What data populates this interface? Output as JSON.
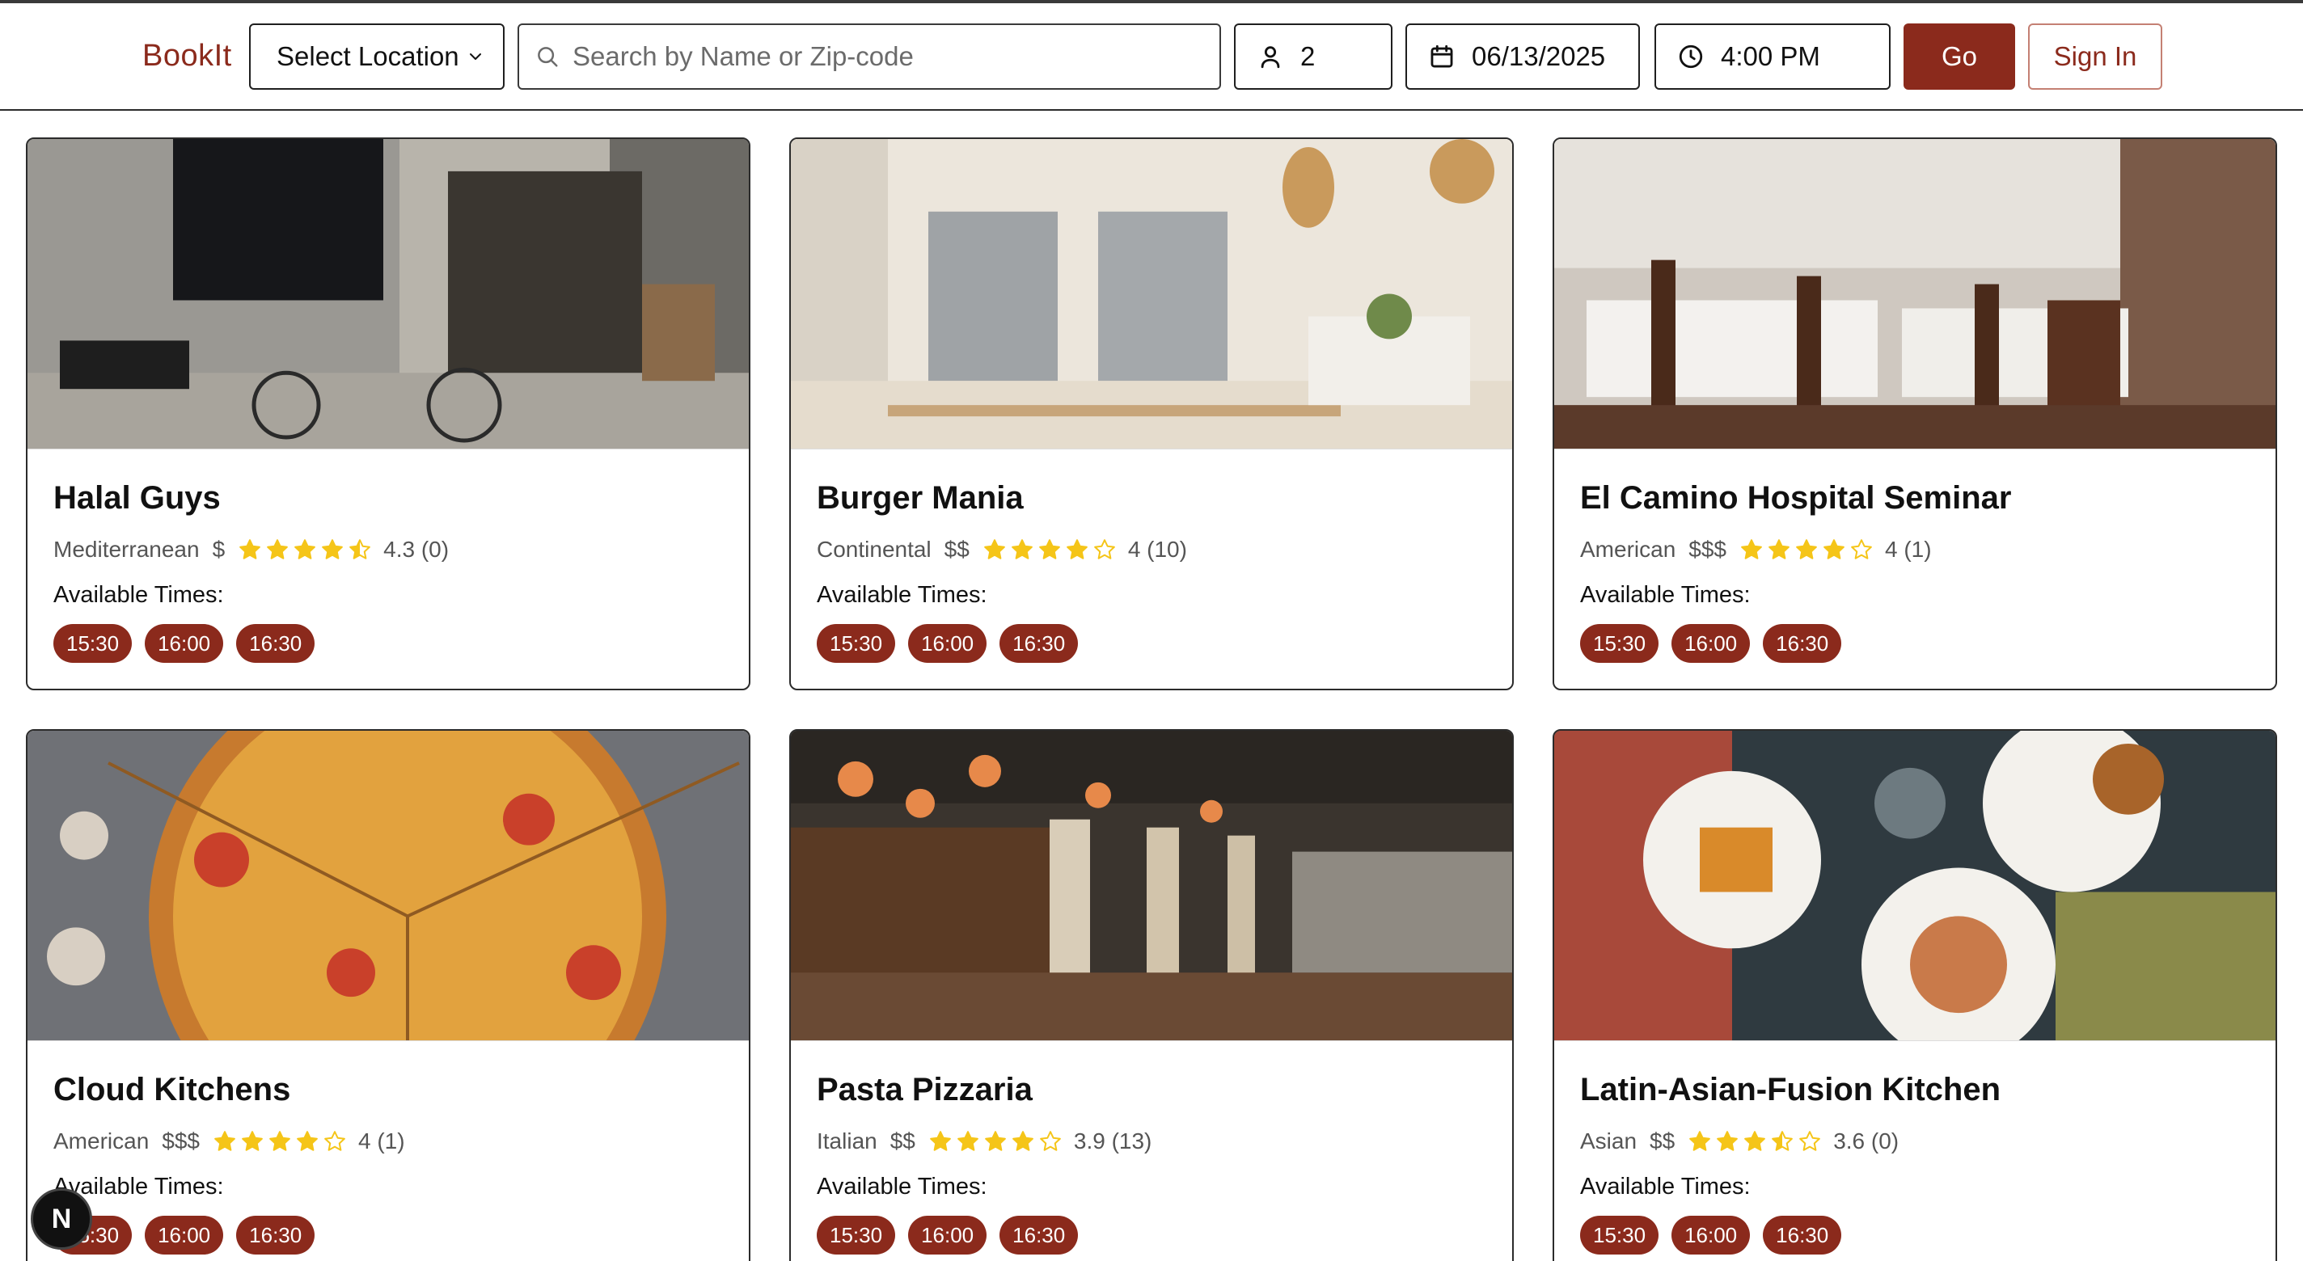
{
  "header": {
    "brand": "BookIt",
    "location_label": "Select Location",
    "search_placeholder": "Search by Name or Zip-code",
    "search_value": "",
    "party_size": "2",
    "date": "06/13/2025",
    "time": "4:00 PM",
    "go_label": "Go",
    "signin_label": "Sign In"
  },
  "colors": {
    "brand": "#8b2a1c",
    "star": "#f5c518",
    "star_empty": "#f5c518"
  },
  "available_label": "Available Times:",
  "restaurants": [
    {
      "name": "Halal Guys",
      "cuisine": "Mediterranean",
      "price": "$",
      "rating_value": 4.3,
      "rating_text": "4.3 (0)",
      "times": [
        "15:30",
        "16:00",
        "16:30"
      ]
    },
    {
      "name": "Burger Mania",
      "cuisine": "Continental",
      "price": "$$",
      "rating_value": 4,
      "rating_text": "4 (10)",
      "times": [
        "15:30",
        "16:00",
        "16:30"
      ]
    },
    {
      "name": "El Camino Hospital Seminar",
      "cuisine": "American",
      "price": "$$$",
      "rating_value": 4,
      "rating_text": "4 (1)",
      "times": [
        "15:30",
        "16:00",
        "16:30"
      ]
    },
    {
      "name": "Cloud Kitchens",
      "cuisine": "American",
      "price": "$$$",
      "rating_value": 4,
      "rating_text": "4 (1)",
      "times": [
        "15:30",
        "16:00",
        "16:30"
      ]
    },
    {
      "name": "Pasta Pizzaria",
      "cuisine": "Italian",
      "price": "$$",
      "rating_value": 3.9,
      "rating_text": "3.9 (13)",
      "times": [
        "15:30",
        "16:00",
        "16:30"
      ]
    },
    {
      "name": "Latin-Asian-Fusion Kitchen",
      "cuisine": "Asian",
      "price": "$$",
      "rating_value": 3.6,
      "rating_text": "3.6 (0)",
      "times": [
        "15:30",
        "16:00",
        "16:30"
      ]
    }
  ],
  "dev_badge": "N"
}
